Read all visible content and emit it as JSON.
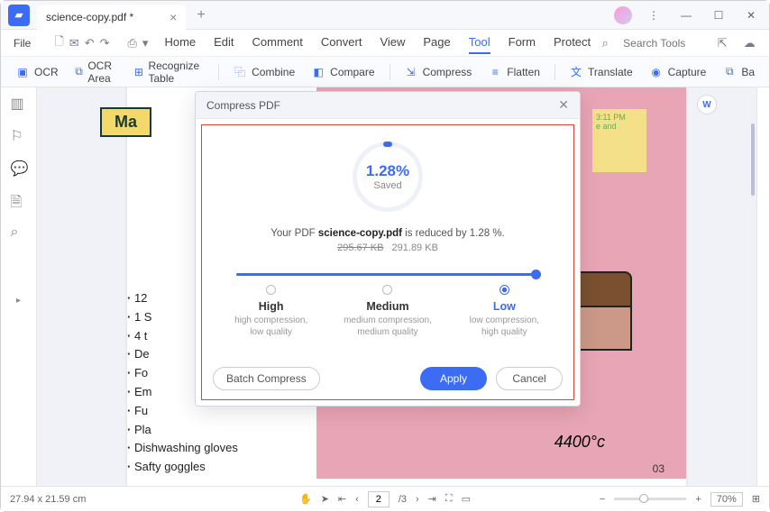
{
  "window": {
    "tab_title": "science-copy.pdf *"
  },
  "menubar": {
    "file": "File",
    "tabs": [
      "Home",
      "Edit",
      "Comment",
      "Convert",
      "View",
      "Page",
      "Tool",
      "Form",
      "Protect"
    ],
    "active_tab": "Tool",
    "search_placeholder": "Search Tools"
  },
  "toolbar": {
    "ocr": "OCR",
    "ocr_area": "OCR Area",
    "recognize_table": "Recognize Table",
    "combine": "Combine",
    "compare": "Compare",
    "compress": "Compress",
    "flatten": "Flatten",
    "translate": "Translate",
    "capture": "Capture",
    "batch": "Ba"
  },
  "document": {
    "header": "Ma",
    "bullets": [
      "12",
      "1 S",
      "4 t",
      "De",
      "Fo",
      "Em",
      "Fu",
      "Pla",
      "Dishwashing gloves",
      "Safty goggles"
    ],
    "sticky_time": "3:11 PM",
    "sticky_line": "e and",
    "temp": "4400°c",
    "page_num": "03"
  },
  "modal": {
    "title": "Compress PDF",
    "percent": "1.28%",
    "saved": "Saved",
    "prefix": "Your PDF ",
    "filename": "science-copy.pdf",
    "suffix": "  is reduced by 1.28 %.",
    "old_size": "295.67 KB",
    "new_size": "291.89 KB",
    "options": {
      "high": {
        "name": "High",
        "desc1": "high compression,",
        "desc2": "low quality"
      },
      "medium": {
        "name": "Medium",
        "desc1": "medium compression,",
        "desc2": "medium quality"
      },
      "low": {
        "name": "Low",
        "desc1": "low compression,",
        "desc2": "high quality"
      }
    },
    "batch": "Batch Compress",
    "apply": "Apply",
    "cancel": "Cancel"
  },
  "status": {
    "dims": "27.94 x 21.59 cm",
    "page_current": "2",
    "page_total": "/3",
    "zoom": "70%"
  }
}
